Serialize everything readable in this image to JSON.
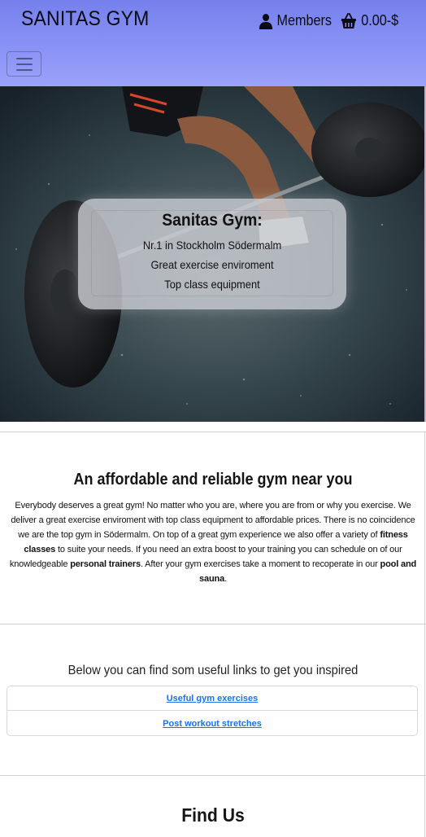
{
  "header": {
    "brand": "SANITAS GYM",
    "members_label": "Members",
    "cart_total": "0.00-$"
  },
  "hero": {
    "title": "Sanitas Gym:",
    "lines": [
      "Nr.1 in Stockholm Södermalm",
      "Great exercise enviroment",
      "Top class equipment"
    ]
  },
  "about": {
    "title": "An affordable and reliable gym near you",
    "p1": "Everybody deserves a great gym! No matter who you are, where you are from or why you exercise. We deliver a great exercise enviroment with top class equipment to affordable prices. There is no coincidence we are the top gym in Södermalm. On top of a great gym experience we also offer a variety of ",
    "b1": "fitness classes",
    "p2": " to suite your needs. If you need an extra boost to your training you can schedule on of our knowledgeable ",
    "b2": "personal trainers",
    "p3": ". After your gym exercises take a moment to recoperate in our ",
    "b3": "pool and sauna",
    "p4": "."
  },
  "links": {
    "intro": "Below you can find som useful links to get you inspired",
    "items": [
      "Useful gym exercises",
      "Post workout stretches"
    ]
  },
  "find": {
    "title": "Find Us"
  },
  "colors": {
    "header_bg": "#8b94f6",
    "link": "#1a73e8"
  }
}
